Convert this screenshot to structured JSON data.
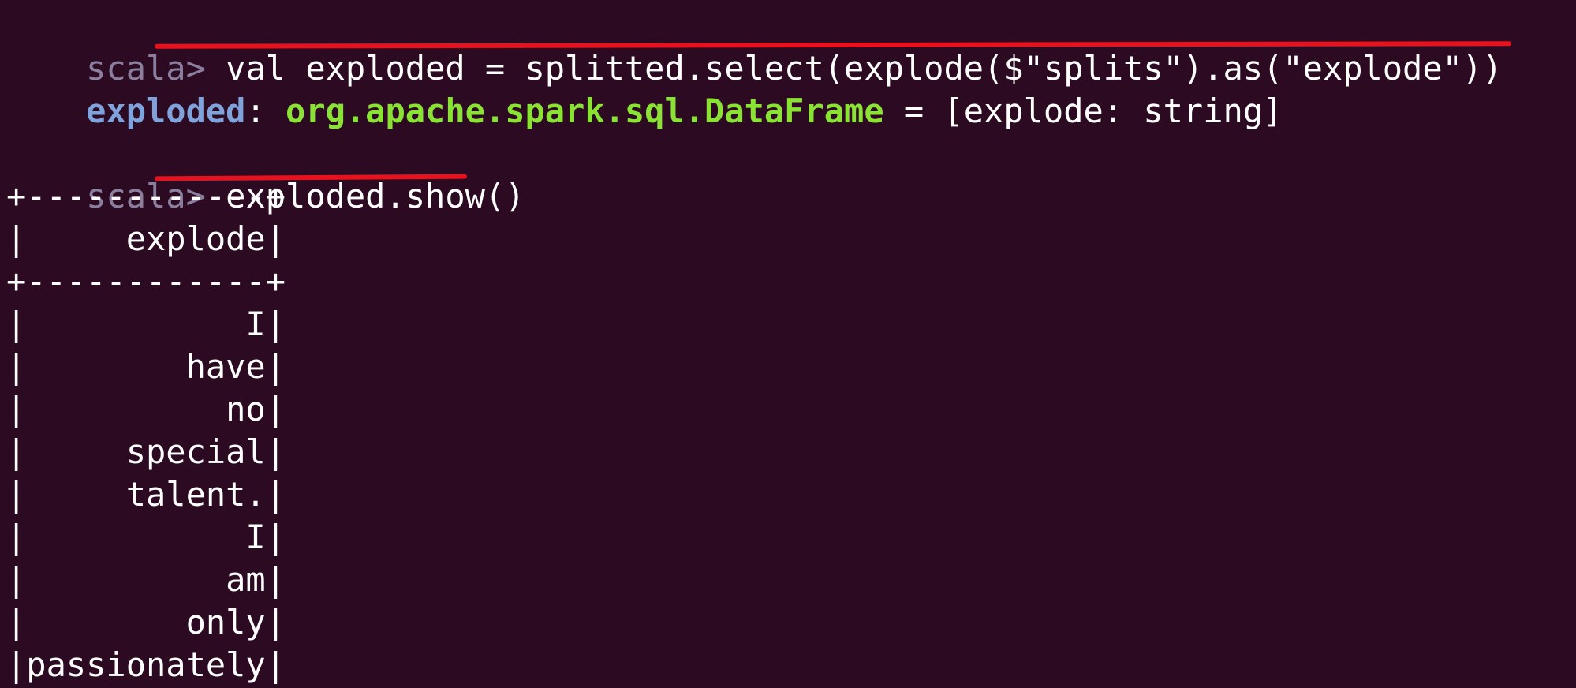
{
  "terminal": {
    "lines": [
      {
        "prompt": "scala> ",
        "command": "val exploded = splitted.select(explode($\"splits\").as(\"explode\"))"
      },
      {
        "name": "exploded",
        "sep": ": ",
        "type": "org.apache.spark.sql.DataFrame",
        "rest": " = [explode: string]"
      },
      {
        "text": ""
      },
      {
        "prompt": "scala> ",
        "command": "exploded.show()"
      },
      {
        "text": "+------------+"
      },
      {
        "text": "|     explode|"
      },
      {
        "text": "+------------+"
      },
      {
        "text": "|           I|"
      },
      {
        "text": "|        have|"
      },
      {
        "text": "|          no|"
      },
      {
        "text": "|     special|"
      },
      {
        "text": "|     talent.|"
      },
      {
        "text": "|           I|"
      },
      {
        "text": "|          am|"
      },
      {
        "text": "|        only|"
      },
      {
        "text": "|passionately|"
      }
    ]
  },
  "colors": {
    "background": "#2c0b22",
    "prompt": "#8a7f9e",
    "text": "#ffffff",
    "value_name": "#7fa3da",
    "type_name": "#8ae234",
    "annotation_underline": "#e8121f"
  }
}
